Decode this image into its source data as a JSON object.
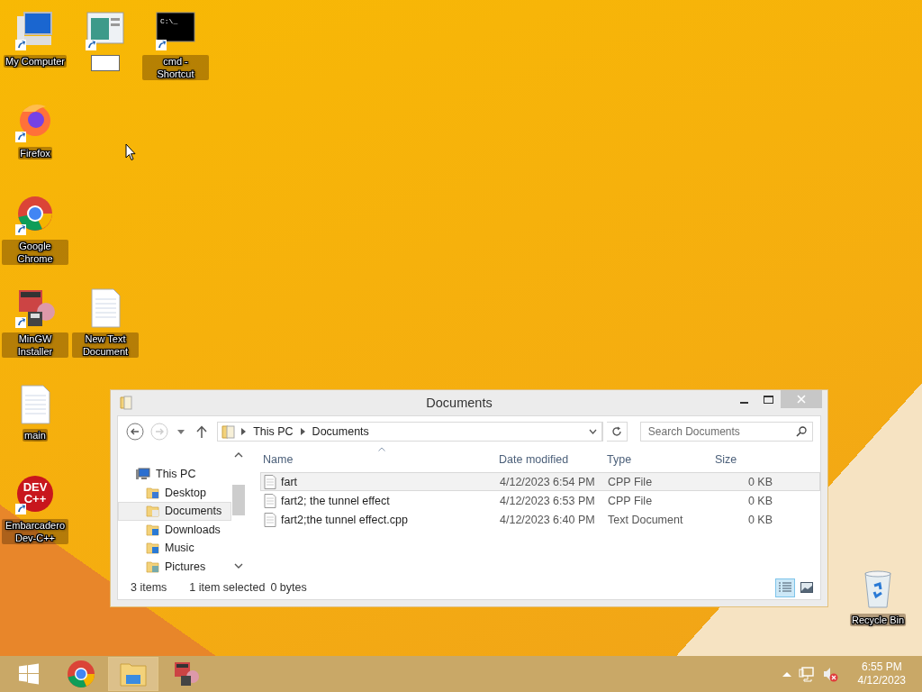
{
  "desktop": {
    "icons": [
      {
        "kind": "computer",
        "label": "My Computer",
        "shortcut": true,
        "renaming": false
      },
      {
        "kind": "window-app",
        "shortcut": true,
        "renaming": true
      },
      {
        "kind": "console",
        "label": "cmd - Shortcut",
        "shortcut": true,
        "renaming": false,
        "screen_text": "C:\\_"
      },
      {
        "kind": "firefox",
        "label": "Firefox",
        "shortcut": true,
        "renaming": false
      },
      {
        "kind": "chrome",
        "label": "Google Chrome",
        "shortcut": true,
        "renaming": false
      },
      {
        "kind": "installer",
        "label": "MinGW Installer",
        "shortcut": true,
        "renaming": false
      },
      {
        "kind": "text-file",
        "label": "New Text Document",
        "shortcut": false,
        "renaming": false
      },
      {
        "kind": "text-file",
        "label": "main",
        "shortcut": false,
        "renaming": false
      },
      {
        "kind": "devcpp",
        "label": "Embarcadero Dev-C++",
        "shortcut": true,
        "renaming": false,
        "logo_text": [
          "DEV",
          "C++"
        ]
      },
      {
        "kind": "recycle-bin",
        "label": "Recycle Bin",
        "shortcut": false,
        "renaming": false
      }
    ]
  },
  "window": {
    "title": "Documents",
    "address": {
      "crumbs": [
        "This PC",
        "Documents"
      ]
    },
    "search": {
      "placeholder": "Search Documents"
    },
    "nav": [
      {
        "kind": "computer",
        "label": "This PC",
        "selected": false,
        "children": [
          {
            "kind": "desktop",
            "label": "Desktop",
            "selected": false
          },
          {
            "kind": "documents",
            "label": "Documents",
            "selected": true
          },
          {
            "kind": "downloads",
            "label": "Downloads",
            "selected": false
          },
          {
            "kind": "music",
            "label": "Music",
            "selected": false
          },
          {
            "kind": "pictures",
            "label": "Pictures",
            "selected": false
          }
        ]
      }
    ],
    "columns": [
      {
        "label": "Name",
        "sorted": true
      },
      {
        "label": "Date modified",
        "sorted": false
      },
      {
        "label": "Type",
        "sorted": false
      },
      {
        "label": "Size",
        "sorted": false
      }
    ],
    "rows": [
      {
        "name": "fart",
        "date": "4/12/2023 6:54 PM",
        "type": "CPP File",
        "size": "0 KB",
        "selected": true
      },
      {
        "name": "fart2; the tunnel effect",
        "date": "4/12/2023 6:53 PM",
        "type": "CPP File",
        "size": "0 KB",
        "selected": false
      },
      {
        "name": "fart2;the tunnel effect.cpp",
        "date": "4/12/2023 6:40 PM",
        "type": "Text Document",
        "size": "0 KB",
        "selected": false
      }
    ],
    "status": {
      "count": "3 items",
      "selection": "1 item selected",
      "bytes": "0 bytes"
    },
    "views": [
      {
        "kind": "details",
        "selected": true
      },
      {
        "kind": "large-icons",
        "selected": false
      }
    ]
  },
  "taskbar": {
    "items": [
      {
        "kind": "start",
        "active": false
      },
      {
        "kind": "chrome",
        "active": false
      },
      {
        "kind": "explorer",
        "active": true
      },
      {
        "kind": "installer",
        "active": false
      }
    ],
    "clock": {
      "time": "6:55 PM",
      "date": "4/12/2023"
    }
  }
}
